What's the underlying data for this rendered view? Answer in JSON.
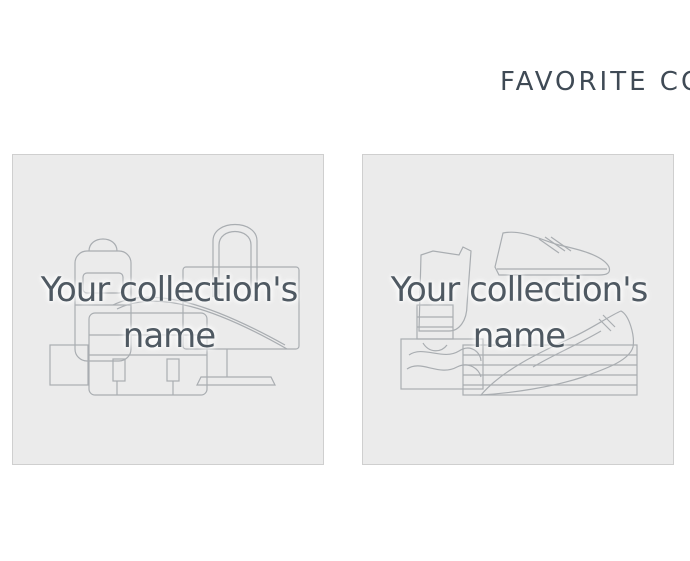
{
  "section": {
    "title": "FAVORITE CO"
  },
  "collections": [
    {
      "name": "Your collection's name",
      "icon": "bags-illustration-icon"
    },
    {
      "name": "Your collection's name",
      "icon": "shoes-illustration-icon"
    }
  ],
  "colors": {
    "card_bg": "#ebebeb",
    "card_border": "#cfcfcf",
    "title_text": "#3f4a55",
    "name_text": "#4f5962",
    "line_art": "#a9adb1"
  }
}
